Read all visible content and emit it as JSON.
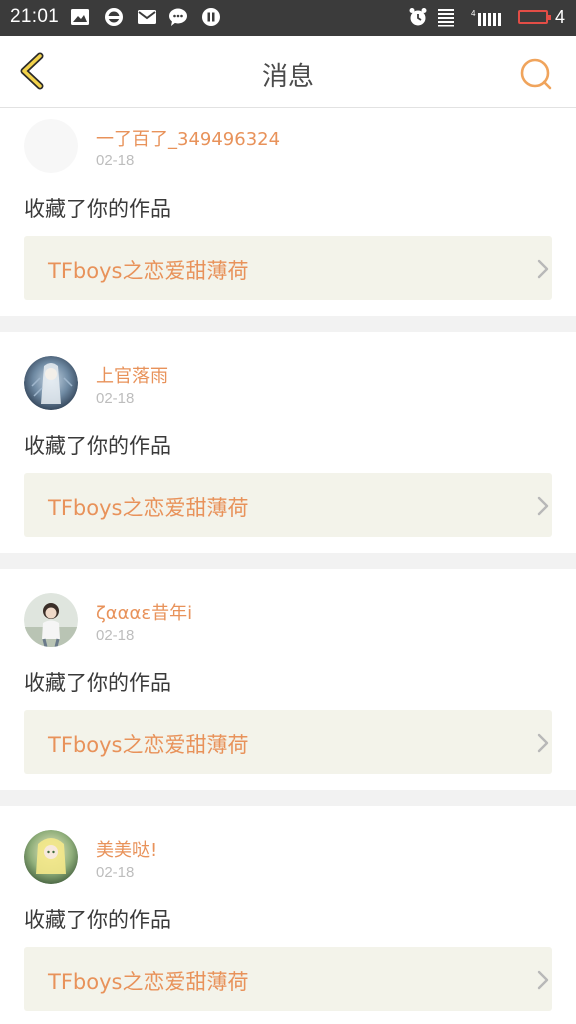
{
  "status_bar": {
    "time": "21:01",
    "battery_level": "4",
    "icons": [
      "image-notification-icon",
      "circle-app-icon",
      "mail-icon",
      "chat-icon",
      "pause-circle-icon",
      "alarm-icon",
      "data-icon",
      "signal-icon",
      "battery-icon"
    ],
    "battery_color": "#e24d46"
  },
  "header": {
    "title": "消息",
    "back_icon": "chevron-left-icon",
    "search_icon": "search-icon",
    "accent_color": "#f0a45c"
  },
  "messages": [
    {
      "username": "一了百了_349496324",
      "date": "02-18",
      "action": "收藏了你的作品",
      "work_title": "TFboys之恋爱甜薄荷"
    },
    {
      "username": "上官落雨",
      "date": "02-18",
      "action": "收藏了你的作品",
      "work_title": "TFboys之恋爱甜薄荷"
    },
    {
      "username": "ζαααε昔年i",
      "date": "02-18",
      "action": "收藏了你的作品",
      "work_title": "TFboys之恋爱甜薄荷"
    },
    {
      "username": "美美哒!",
      "date": "02-18",
      "action": "收藏了你的作品",
      "work_title": "TFboys之恋爱甜薄荷"
    }
  ],
  "colors": {
    "username": "#e8925a",
    "work_bg": "#f3f3ea"
  }
}
